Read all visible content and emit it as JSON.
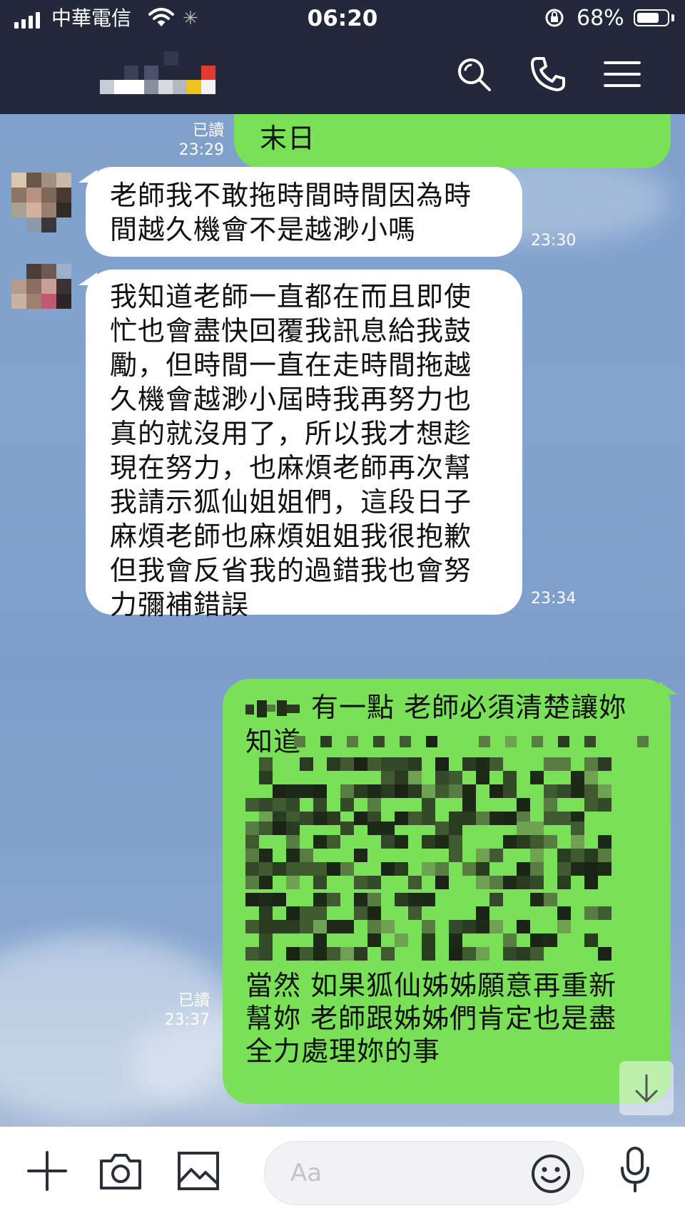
{
  "status_bar": {
    "carrier": "中華電信",
    "time": "06:20",
    "battery_percent": "68%",
    "battery_level": 0.68
  },
  "header": {
    "chat_name": "",
    "icons": [
      "search-icon",
      "phone-icon",
      "menu-icon"
    ]
  },
  "messages": [
    {
      "direction": "outgoing",
      "read_label": "已讀",
      "time": "23:29",
      "text": "末日"
    },
    {
      "direction": "incoming",
      "time": "23:30",
      "lines": [
        "老師我不敢拖時間時間因為時",
        "間越久機會不是越渺小嗎"
      ]
    },
    {
      "direction": "incoming",
      "time": "23:34",
      "lines": [
        "我知道老師一直都在而且即使",
        "忙也會盡快回覆我訊息給我鼓",
        "勵，但時間一直在走時間拖越",
        "久機會越渺小屆時我再努力也",
        "真的就沒用了，所以我才想趁",
        "現在努力，也麻煩老師再次幫",
        "我請示狐仙姐姐們，這段日子",
        "麻煩老師也麻煩姐姐我很抱歉",
        "但我會反省我的過錯我也會努",
        "力彌補錯誤"
      ]
    },
    {
      "direction": "outgoing",
      "read_label": "已讀",
      "time": "23:37",
      "line1": "有一點 老師必須清楚讓妳",
      "line2": "知道",
      "end_lines": [
        "當然 如果狐仙姊姊願意再重新",
        "幫妳 老師跟姊姊們肯定也是盡",
        "全力處理妳的事"
      ]
    }
  ],
  "input_bar": {
    "placeholder": "Aa",
    "icons": [
      "plus-icon",
      "camera-icon",
      "image-icon",
      "emoji-icon",
      "microphone-icon"
    ]
  },
  "colors": {
    "header_bg": "#23283a",
    "outgoing_bubble": "#79e057",
    "incoming_bubble": "#ffffff",
    "chat_bg": "#7fa0cc"
  }
}
